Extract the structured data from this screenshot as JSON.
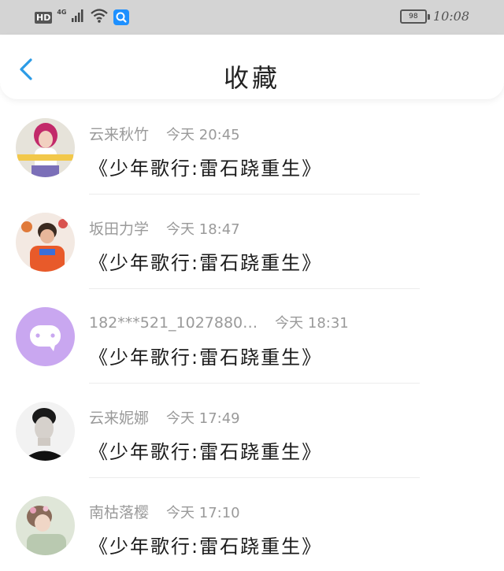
{
  "status_bar": {
    "hd": "HD",
    "network": "4G",
    "battery": "98",
    "time": "10:08"
  },
  "header": {
    "title": "收藏"
  },
  "favorites": [
    {
      "user": "云来秋竹",
      "time": "今天 20:45",
      "title": "《少年歌行:雷石跷重生》"
    },
    {
      "user": "坂田力学",
      "time": "今天 18:47",
      "title": "《少年歌行:雷石跷重生》"
    },
    {
      "user": "182***521_1027880…",
      "time": "今天 18:31",
      "title": "《少年歌行:雷石跷重生》"
    },
    {
      "user": "云来妮娜",
      "time": "今天 17:49",
      "title": "《少年歌行:雷石跷重生》"
    },
    {
      "user": "南枯落樱",
      "time": "今天 17:10",
      "title": "《少年歌行:雷石跷重生》"
    }
  ],
  "colors": {
    "accent": "#2b9be6",
    "status_bar": "#d4d4d4",
    "meta_text": "#9a9a9a",
    "avatar_default": "#c9a7f0"
  }
}
